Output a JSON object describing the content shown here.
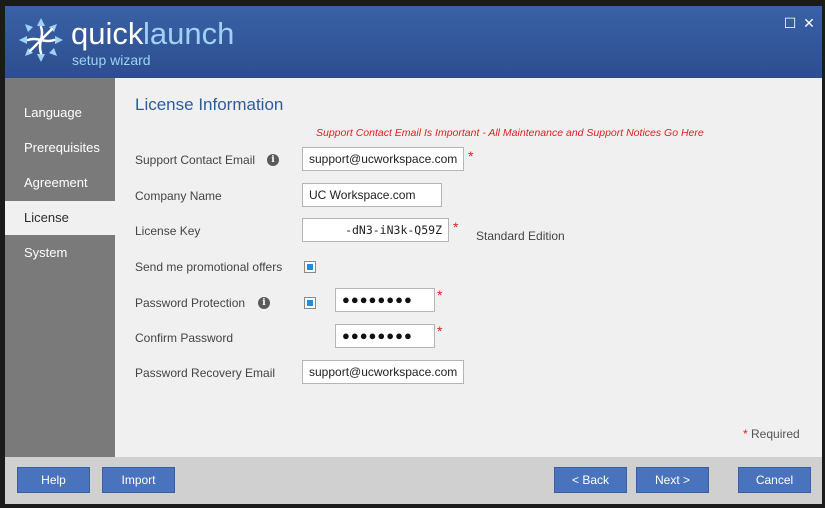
{
  "app": {
    "logo_word1": "quick",
    "logo_word2": "launch",
    "subtitle": "setup wizard",
    "maximize_glyph": "☐",
    "close_glyph": "✕"
  },
  "sidebar": {
    "items": [
      {
        "label": "Language"
      },
      {
        "label": "Prerequisites"
      },
      {
        "label": "Agreement"
      },
      {
        "label": "License",
        "active": true
      },
      {
        "label": "System"
      }
    ]
  },
  "form": {
    "title": "License Information",
    "note": "Support Contact Email Is Important - All Maintenance and Support Notices Go Here",
    "support_email_label": "Support Contact Email",
    "support_email_value": "support@ucworkspace.com",
    "company_label": "Company Name",
    "company_value": "UC Workspace.com",
    "license_label": "License Key",
    "license_value": "-dN3-iN3k-Q59Z",
    "edition": "Standard Edition",
    "promo_label": "Send me promotional offers",
    "promo_checked": true,
    "pw_protect_label": "Password Protection",
    "pw_protect_checked": true,
    "password_value": "●●●●●●●●",
    "confirm_label": "Confirm Password",
    "confirm_value": "●●●●●●●●",
    "recovery_label": "Password Recovery Email",
    "recovery_value": "support@ucworkspace.com",
    "required_star": "*",
    "required_text": "Required",
    "info_glyph": "i"
  },
  "footer": {
    "help": "Help",
    "import": "Import",
    "back": "< Back",
    "next": "Next >",
    "cancel": "Cancel"
  },
  "colors": {
    "header": "#3a61a6",
    "accent_light": "#9ed2f6",
    "button": "#4a73bd",
    "required": "#e02020",
    "sidebar": "#7a7a7a"
  }
}
